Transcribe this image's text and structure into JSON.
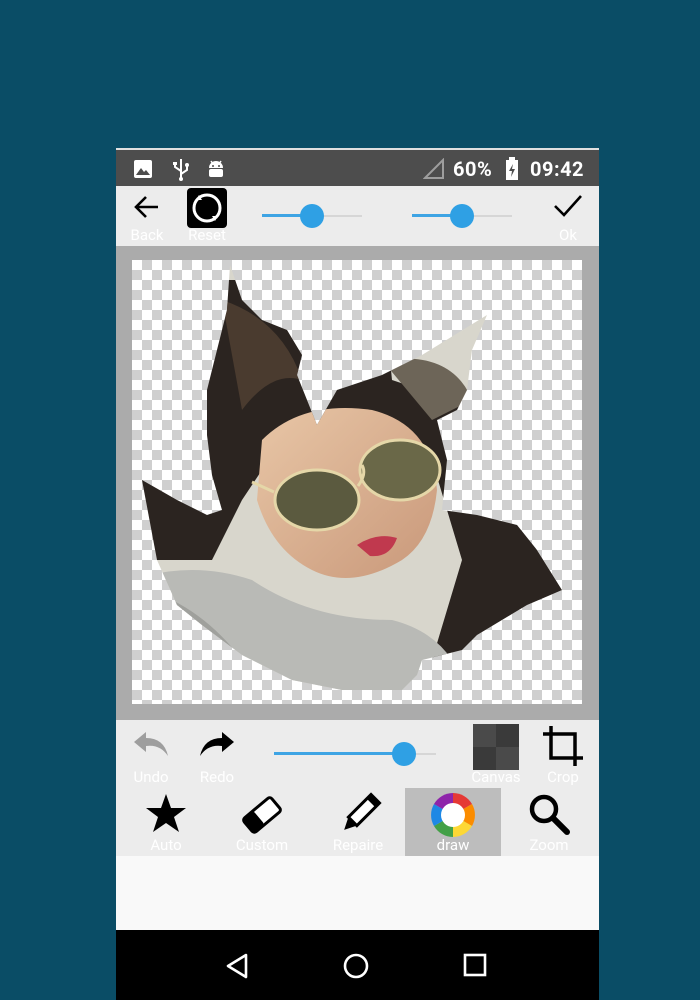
{
  "status_bar": {
    "battery": "60%",
    "time": "09:42",
    "icons": [
      "image-icon",
      "usb-icon",
      "android-icon",
      "signal-icon",
      "battery-charging-icon"
    ]
  },
  "toolbar": {
    "back_label": "Back",
    "reset_label": "Reset",
    "ok_label": "Ok",
    "slider1_value": 0.5,
    "slider2_value": 0.5
  },
  "bottom_tools_1": {
    "undo_label": "Undo",
    "redo_label": "Redo",
    "canvas_label": "Canvas",
    "crop_label": "Crop",
    "slider_value": 0.8
  },
  "bottom_tools_2": {
    "items": [
      {
        "label": "Auto",
        "icon": "star-icon"
      },
      {
        "label": "Custom",
        "icon": "eraser-icon"
      },
      {
        "label": "Repaire",
        "icon": "pencil-icon"
      },
      {
        "label": "draw",
        "icon": "color-wheel-icon",
        "selected": true
      },
      {
        "label": "Zoom",
        "icon": "magnifier-icon"
      }
    ]
  },
  "colors": {
    "background": "#0a4d66",
    "accent": "#2fa0e4",
    "toolbar": "#ececec",
    "status_bar": "#4d4d4d"
  }
}
